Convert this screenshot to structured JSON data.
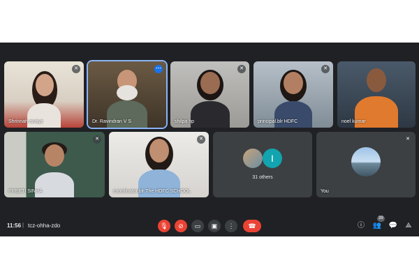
{
  "participants": [
    {
      "name": "Shrinnah awayz"
    },
    {
      "name": "Dr. Ravindran V S"
    },
    {
      "name": "shilpa hp"
    },
    {
      "name": "principal.blr HDFC"
    },
    {
      "name": "noel kumar"
    },
    {
      "name": "PREETI SINHA"
    },
    {
      "name": "coordinator.blr The HDFC SCHOOL"
    },
    {
      "others_label": "31 others"
    },
    {
      "name": "You"
    }
  ],
  "others_avatar_letter": "I",
  "bottom_bar": {
    "time": "11:56",
    "separator": "|",
    "meeting_code": "tcz-ohha-zdo",
    "people_count": "39"
  },
  "colors": {
    "background": "#202124",
    "tile": "#3c4043",
    "end_call": "#ea4335",
    "avatar_teal": "#12a4af",
    "active_border": "#8ab4f8"
  }
}
